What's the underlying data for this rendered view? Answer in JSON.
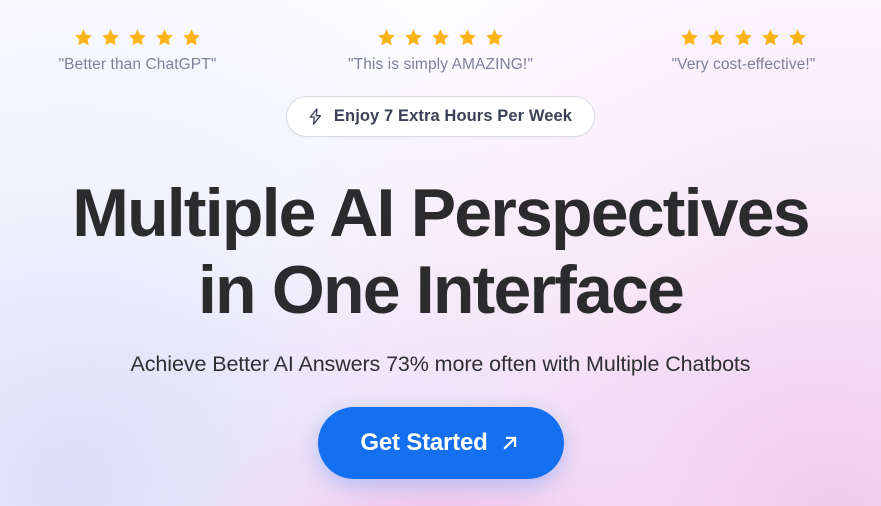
{
  "theme": {
    "star_color": "#fbb418",
    "quote_color": "#7d8199",
    "badge_border_color": "#d9dbe3",
    "badge_text_color": "#3c4256",
    "headline_color": "#2b2b2e",
    "subheadline_color": "#2f2f33",
    "cta_background_color": "#1570f0",
    "cta_text_color": "#ffffff",
    "page_background_color": "#fdfdff",
    "glow_pink": "#eeb0e4",
    "glow_lavender": "#d6d8f7"
  },
  "testimonials": [
    {
      "stars": 5,
      "star_icon": "star-icon",
      "quote": "\"Better than ChatGPT\""
    },
    {
      "stars": 5,
      "star_icon": "star-icon",
      "quote": "\"This is simply AMAZING!\""
    },
    {
      "stars": 5,
      "star_icon": "star-icon",
      "quote": "\"Very cost-effective!\""
    }
  ],
  "badge": {
    "icon": "lightning-bolt-icon",
    "label": "Enjoy 7 Extra Hours Per Week"
  },
  "hero": {
    "headline_line_1": "Multiple AI Perspectives",
    "headline_line_2": "in One Interface",
    "subheadline": "Achieve Better AI Answers 73% more often with Multiple Chatbots"
  },
  "cta": {
    "label": "Get Started",
    "icon": "arrow-up-right-icon",
    "icon_glyph": "↗"
  }
}
